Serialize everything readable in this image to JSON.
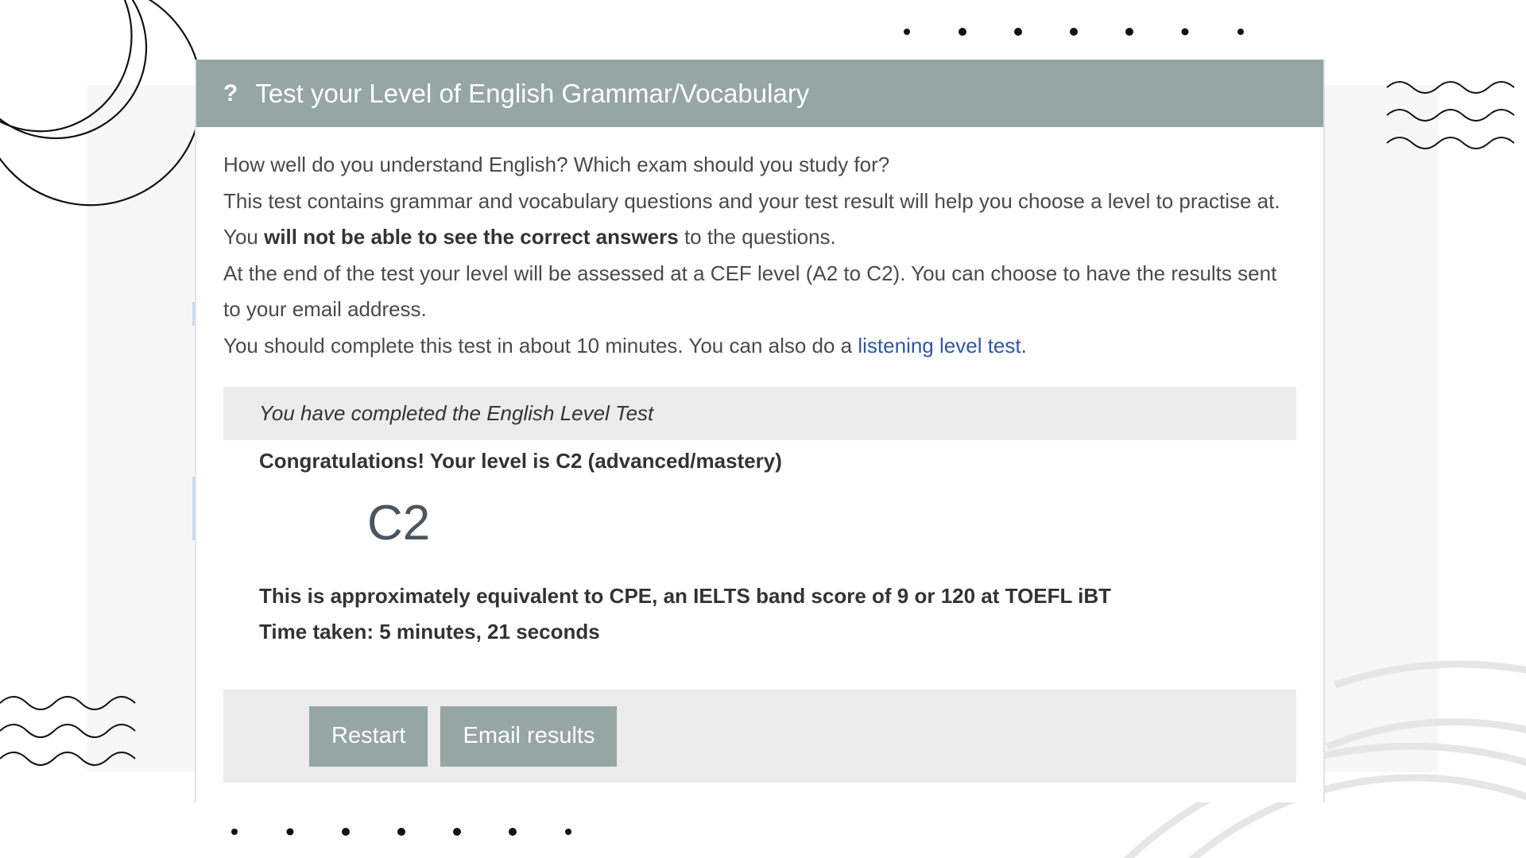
{
  "card": {
    "header_icon": "?",
    "title": "Test your Level of English Grammar/Vocabulary"
  },
  "intro": {
    "line1": "How well do you understand English? Which exam should you study for?",
    "line2_start": "This test contains grammar and vocabulary questions and your test result will help you choose a level to practise at. You ",
    "line2_bold": "will not be able to see the correct answers",
    "line2_end": " to the questions.",
    "line3": "At the end of the test your level will be assessed at a CEF level (A2 to C2). You can choose to have the results sent to your email address.",
    "line4_start": "You should complete this test in about 10 minutes. You can also do a ",
    "line4_link": "listening level test",
    "line4_end": "."
  },
  "result": {
    "banner": "You have completed the English Level Test",
    "congrats": "Congratulations! Your level is C2 (advanced/mastery)",
    "level": "C2",
    "equivalent": "This is approximately equivalent to CPE, an IELTS band score of 9 or 120 at TOEFL iBT",
    "time_taken": "Time taken: 5 minutes, 21 seconds"
  },
  "actions": {
    "restart_label": "Restart",
    "email_label": "Email results"
  },
  "colors": {
    "header_bg": "#96a6a2",
    "link": "#2f56a5",
    "panel_bg": "#ececec"
  }
}
